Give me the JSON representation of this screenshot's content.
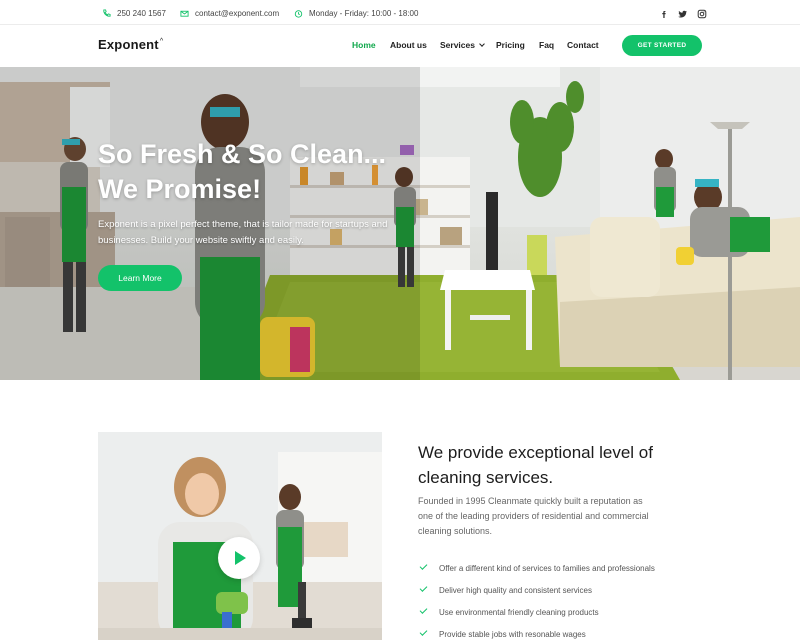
{
  "topbar": {
    "phone": "250 240 1567",
    "email": "contact@exponent.com",
    "hours": "Monday - Friday: 10:00 - 18:00",
    "social_icons": [
      "facebook-icon",
      "twitter-icon",
      "instagram-icon"
    ]
  },
  "nav": {
    "logo": "Exponent",
    "logo_mark": "^",
    "items": [
      {
        "label": "Home",
        "active": true
      },
      {
        "label": "About us",
        "active": false
      },
      {
        "label": "Services",
        "active": false,
        "dropdown": true
      },
      {
        "label": "Pricing",
        "active": false
      },
      {
        "label": "Faq",
        "active": false
      },
      {
        "label": "Contact",
        "active": false
      }
    ],
    "cta": "GET STARTED"
  },
  "hero": {
    "title_line1": "So Fresh & So Clean...",
    "title_line2": "We Promise!",
    "text": "Exponent is a pixel perfect theme, that is tailor made for startups and businesses. Build your website swiftly and easily.",
    "button": "Learn More"
  },
  "about": {
    "title": "We provide exceptional level of cleaning services.",
    "text": "Founded in 1995 Cleanmate quickly built a reputation as one of the leading providers of residential and commercial cleaning solutions.",
    "features": [
      "Offer a different kind of services to families and professionals",
      "Deliver high quality and consistent services",
      "Use environmental friendly cleaning products",
      "Provide stable jobs with resonable wages"
    ]
  },
  "colors": {
    "accent": "#13c26a",
    "active_link": "#10a84c",
    "heading": "#1c1c1c",
    "body_text": "#666666"
  }
}
